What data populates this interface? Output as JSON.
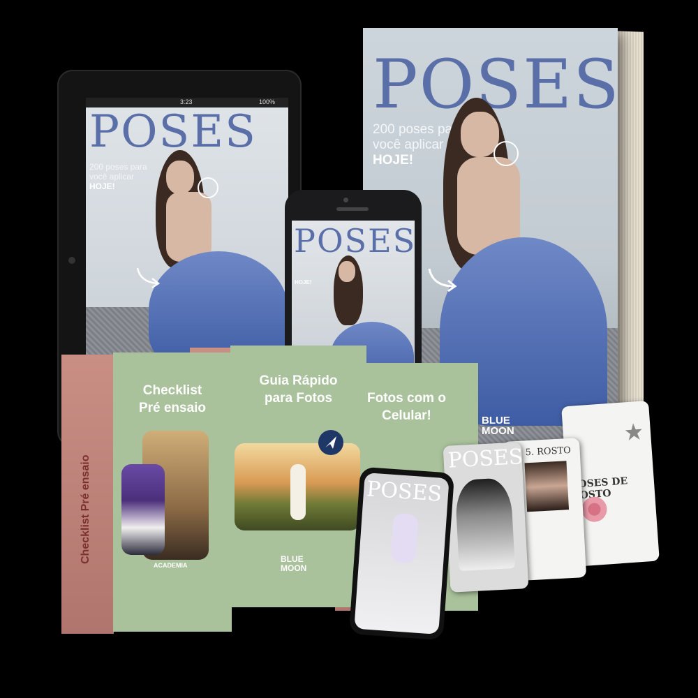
{
  "ebook": {
    "title": "POSES",
    "subtitle_line1": "200 poses para",
    "subtitle_line2": "você aplicar",
    "subtitle_strong": "HOJE!",
    "brand_line1": "BLUE",
    "brand_line2": "MOON"
  },
  "tablet": {
    "status_time": "3:23",
    "status_battery": "100%",
    "title": "POSES",
    "subtitle_line1": "200 poses para",
    "subtitle_line2": "você aplicar",
    "subtitle_strong": "HOJE!"
  },
  "phone": {
    "title": "POSES",
    "subtitle_strong": "HOJE!"
  },
  "boxes": [
    {
      "title_line1": "Checklist",
      "title_line2": "Pré ensaio",
      "spine": "Checklist Pré ensaio",
      "logo": "ACADEMIA"
    },
    {
      "title_line1": "Guia Rápido",
      "title_line2": "para Fotos",
      "logo_line1": "BLUE",
      "logo_line2": "MOON"
    },
    {
      "title_line1": "Fotos com o",
      "title_line2": "Celular!"
    }
  ],
  "cards": {
    "phone_title": "POSES",
    "mid_title": "POSES",
    "rosto_heading": "5. ROSTO",
    "poses_de_rosto": "POSES DE ROSTO"
  },
  "colors": {
    "title_blue": "#5a6fa8",
    "dress_blue": "#5a78bd",
    "box_green": "#a9c29b",
    "box_pink": "#c98e84"
  }
}
